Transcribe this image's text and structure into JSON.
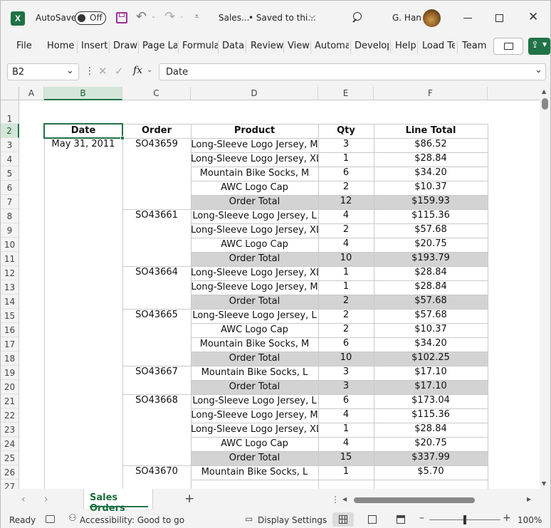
{
  "title_bar": {
    "autosave_label": "AutoSave",
    "autosave_state": "Off",
    "doc_title": "Sales...",
    "save_status": "• Saved to thi...",
    "user_name": "G. Han"
  },
  "ribbon": {
    "tabs": [
      "File",
      "Home",
      "Insert",
      "Draw",
      "Page La",
      "Formula",
      "Data",
      "Review",
      "View",
      "Automat",
      "Develop",
      "Help",
      "Load Te",
      "Team"
    ]
  },
  "formula_bar": {
    "name_box": "B2",
    "fx": "fx",
    "formula": "Date"
  },
  "sheet": {
    "col_headers": [
      "A",
      "B",
      "C",
      "D",
      "E",
      "F"
    ],
    "row_headers": [
      "1",
      "2",
      "3",
      "4",
      "5",
      "6",
      "7",
      "8",
      "9",
      "10",
      "11",
      "12",
      "13",
      "14",
      "15",
      "16",
      "17",
      "18",
      "19",
      "20",
      "21",
      "22",
      "23",
      "24",
      "25",
      "26",
      "27"
    ],
    "headers": {
      "date": "Date",
      "order": "Order",
      "product": "Product",
      "qty": "Qty",
      "line_total": "Line Total"
    },
    "date_value": "May 31, 2011",
    "orders": [
      "SO43659",
      "SO43661",
      "SO43664",
      "SO43665",
      "SO43667",
      "SO43668",
      "SO43670"
    ],
    "rows": [
      {
        "product": "Long-Sleeve Logo Jersey, M",
        "qty": "3",
        "total": "$86.52"
      },
      {
        "product": "Long-Sleeve Logo Jersey, XL",
        "qty": "1",
        "total": "$28.84"
      },
      {
        "product": "Mountain Bike Socks, M",
        "qty": "6",
        "total": "$34.20"
      },
      {
        "product": "AWC Logo Cap",
        "qty": "2",
        "total": "$10.37"
      },
      {
        "product": "Order Total",
        "qty": "12",
        "total": "$159.93"
      },
      {
        "product": "Long-Sleeve Logo Jersey, L",
        "qty": "4",
        "total": "$115.36"
      },
      {
        "product": "Long-Sleeve Logo Jersey, XL",
        "qty": "2",
        "total": "$57.68"
      },
      {
        "product": "AWC Logo Cap",
        "qty": "4",
        "total": "$20.75"
      },
      {
        "product": "Order Total",
        "qty": "10",
        "total": "$193.79"
      },
      {
        "product": "Long-Sleeve Logo Jersey, XL",
        "qty": "1",
        "total": "$28.84"
      },
      {
        "product": "Long-Sleeve Logo Jersey, M",
        "qty": "1",
        "total": "$28.84"
      },
      {
        "product": "Order Total",
        "qty": "2",
        "total": "$57.68"
      },
      {
        "product": "Long-Sleeve Logo Jersey, L",
        "qty": "2",
        "total": "$57.68"
      },
      {
        "product": "AWC Logo Cap",
        "qty": "2",
        "total": "$10.37"
      },
      {
        "product": "Mountain Bike Socks, M",
        "qty": "6",
        "total": "$34.20"
      },
      {
        "product": "Order Total",
        "qty": "10",
        "total": "$102.25"
      },
      {
        "product": "Mountain Bike Socks, L",
        "qty": "3",
        "total": "$17.10"
      },
      {
        "product": "Order Total",
        "qty": "3",
        "total": "$17.10"
      },
      {
        "product": "Long-Sleeve Logo Jersey, L",
        "qty": "6",
        "total": "$173.04"
      },
      {
        "product": "Long-Sleeve Logo Jersey, M",
        "qty": "4",
        "total": "$115.36"
      },
      {
        "product": "Long-Sleeve Logo Jersey, XL",
        "qty": "1",
        "total": "$28.84"
      },
      {
        "product": "AWC Logo Cap",
        "qty": "4",
        "total": "$20.75"
      },
      {
        "product": "Order Total",
        "qty": "15",
        "total": "$337.99"
      },
      {
        "product": "Mountain Bike Socks, L",
        "qty": "1",
        "total": "$5.70"
      }
    ]
  },
  "sheet_tabs": {
    "active": "Sales Orders",
    "add": "+"
  },
  "status_bar": {
    "ready": "Ready",
    "accessibility": "Accessibility: Good to go",
    "display_settings": "Display Settings",
    "zoom": "100%"
  },
  "colors": {
    "excel_green": "#217346",
    "selection": "#217346",
    "total_fill": "#d3d3d3"
  }
}
